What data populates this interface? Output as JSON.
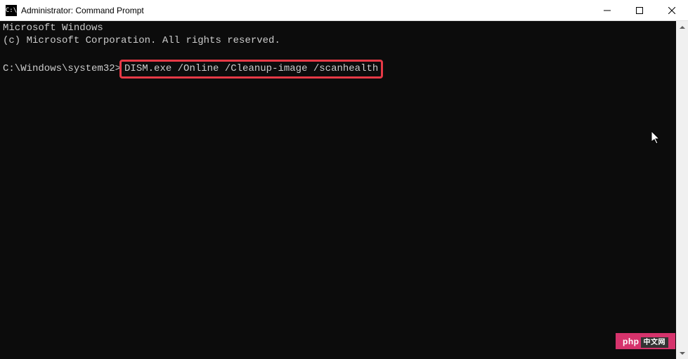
{
  "window": {
    "title": "Administrator: Command Prompt",
    "icon_label": "C:\\"
  },
  "terminal": {
    "line1": "Microsoft Windows",
    "line2": "(c) Microsoft Corporation. All rights reserved.",
    "prompt": "C:\\Windows\\system32>",
    "command": "DISM.exe /Online /Cleanup-image /scanhealth"
  },
  "watermark": {
    "text": "php",
    "suffix": "中文网"
  }
}
